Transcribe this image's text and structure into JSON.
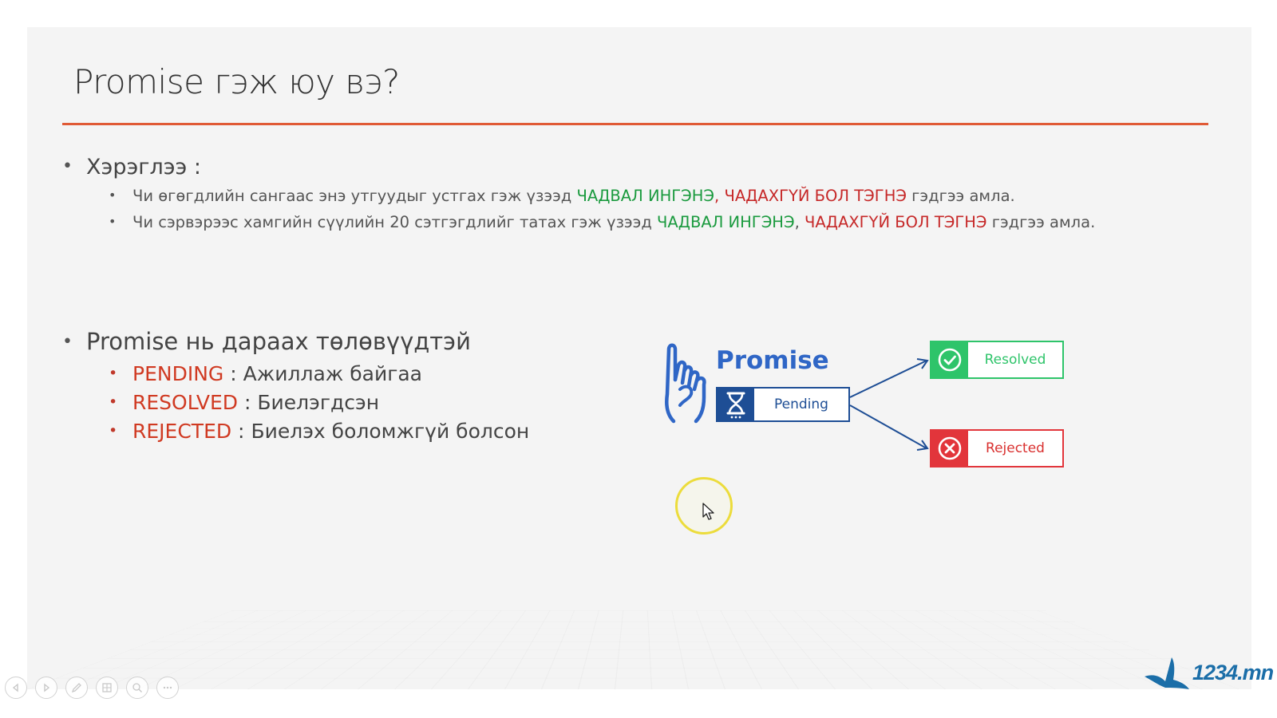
{
  "slide": {
    "title": "Promise гэж юу вэ?",
    "usage": {
      "heading": "Хэрэглээ :",
      "items": [
        {
          "before": "Чи өгөгдлийн сангаас энэ утгуудыг устгах гэж үзээд ",
          "success": "ЧАДВАЛ ИНГЭНЭ",
          "sep": ", ",
          "failure": "ЧАДАХГҮЙ БОЛ ТЭГНЭ",
          "after": " гэдгээ амла."
        },
        {
          "before": "Чи сэрвэрээс хамгийн сүүлийн 20 сэтгэгдлийг татах гэж үзээд ",
          "success": "ЧАДВАЛ ИНГЭНЭ",
          "sep": ", ",
          "failure": "ЧАДАХГҮЙ БОЛ ТЭГНЭ",
          "after": " гэдгээ амла."
        }
      ]
    },
    "states": {
      "heading": "Promise нь дараах төлөвүүдтэй",
      "items": [
        {
          "name": "PENDING",
          "sep": " : ",
          "desc": "Ажиллаж байгаа"
        },
        {
          "name": "RESOLVED",
          "sep": " : ",
          "desc": "Биелэгдсэн"
        },
        {
          "name": "REJECTED",
          "sep": " : ",
          "desc": "Биелэх боломжгүй болсон"
        }
      ]
    },
    "diagram": {
      "title": "Promise",
      "pending": "Pending",
      "resolved": "Resolved",
      "rejected": "Rejected",
      "icons": [
        "hand-icon",
        "hourglass-icon",
        "check-circle-icon",
        "x-circle-icon"
      ],
      "colors": {
        "blue": "#2f66c6",
        "navy": "#1e4e95",
        "green": "#2ec46a",
        "red": "#e2353b"
      }
    }
  },
  "toolbar": {
    "buttons": [
      "previous-icon",
      "next-icon",
      "pen-icon",
      "slides-grid-icon",
      "zoom-icon",
      "more-icon"
    ]
  },
  "watermark": {
    "text": "1234.mn"
  },
  "colors": {
    "accent_rule": "#e05a36",
    "success": "#1a9a3e",
    "failure": "#c62828",
    "state": "#d03a22"
  }
}
